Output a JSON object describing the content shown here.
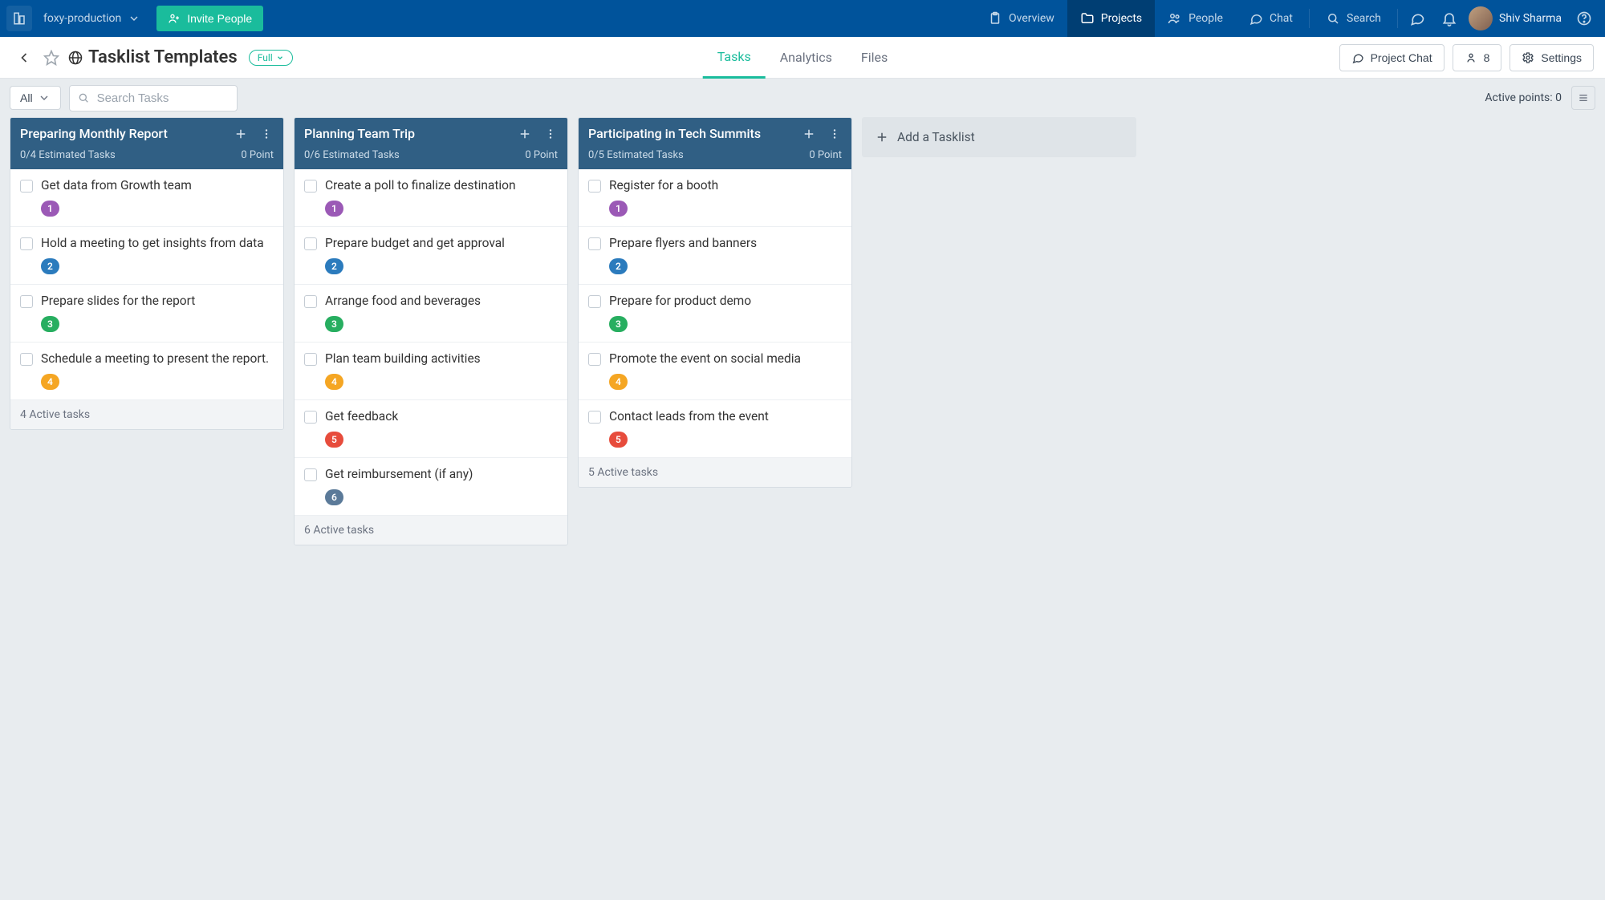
{
  "workspace": {
    "name": "foxy-production"
  },
  "invite_label": "Invite People",
  "topnav": {
    "overview": "Overview",
    "projects": "Projects",
    "people": "People",
    "chat": "Chat",
    "search": "Search"
  },
  "user": {
    "name": "Shiv Sharma"
  },
  "page": {
    "title": "Tasklist Templates",
    "visibility": "Full"
  },
  "tabs": {
    "tasks": "Tasks",
    "analytics": "Analytics",
    "files": "Files"
  },
  "subheader_buttons": {
    "chat": "Project Chat",
    "members": "8",
    "settings": "Settings"
  },
  "toolbar": {
    "filter": "All",
    "search_placeholder": "Search Tasks",
    "active_points_label": "Active points:",
    "active_points_value": "0"
  },
  "add_tasklist_label": "Add a Tasklist",
  "columns": [
    {
      "title": "Preparing Monthly Report",
      "estimated": "0/4 Estimated Tasks",
      "points": "0 Point",
      "footer": "4 Active tasks",
      "cards": [
        {
          "title": "Get data from Growth team",
          "badge": "1",
          "color": "c-purple"
        },
        {
          "title": "Hold a meeting to get insights from data",
          "badge": "2",
          "color": "c-blue"
        },
        {
          "title": "Prepare slides for the report",
          "badge": "3",
          "color": "c-green"
        },
        {
          "title": "Schedule a meeting to present the report.",
          "badge": "4",
          "color": "c-orange"
        }
      ]
    },
    {
      "title": "Planning Team Trip",
      "estimated": "0/6 Estimated Tasks",
      "points": "0 Point",
      "footer": "6 Active tasks",
      "cards": [
        {
          "title": "Create a poll to finalize destination",
          "badge": "1",
          "color": "c-purple"
        },
        {
          "title": "Prepare budget and get approval",
          "badge": "2",
          "color": "c-blue"
        },
        {
          "title": "Arrange food and beverages",
          "badge": "3",
          "color": "c-green"
        },
        {
          "title": "Plan team building activities",
          "badge": "4",
          "color": "c-orange"
        },
        {
          "title": "Get feedback",
          "badge": "5",
          "color": "c-red"
        },
        {
          "title": "Get reimbursement (if any)",
          "badge": "6",
          "color": "c-slate"
        }
      ]
    },
    {
      "title": "Participating in Tech Summits",
      "estimated": "0/5 Estimated Tasks",
      "points": "0 Point",
      "footer": "5 Active tasks",
      "cards": [
        {
          "title": "Register for a booth",
          "badge": "1",
          "color": "c-purple"
        },
        {
          "title": "Prepare flyers and banners",
          "badge": "2",
          "color": "c-blue"
        },
        {
          "title": "Prepare for product demo",
          "badge": "3",
          "color": "c-green"
        },
        {
          "title": "Promote the event on social media",
          "badge": "4",
          "color": "c-orange"
        },
        {
          "title": "Contact leads from the event",
          "badge": "5",
          "color": "c-red"
        }
      ]
    }
  ]
}
